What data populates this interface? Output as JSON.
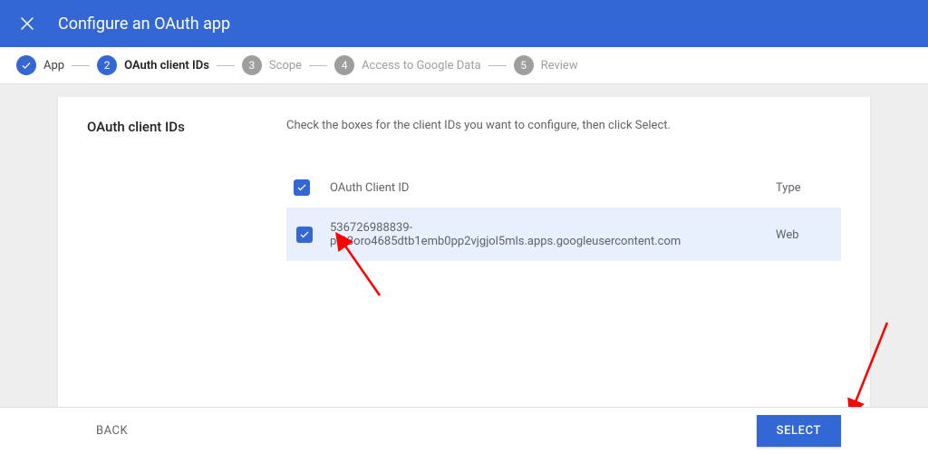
{
  "header": {
    "title": "Configure an OAuth app"
  },
  "stepper": {
    "steps": [
      {
        "label": "App",
        "state": "completed"
      },
      {
        "label": "OAuth client IDs",
        "state": "active",
        "num": "2"
      },
      {
        "label": "Scope",
        "state": "pending",
        "num": "3"
      },
      {
        "label": "Access to Google Data",
        "state": "pending",
        "num": "4"
      },
      {
        "label": "Review",
        "state": "pending",
        "num": "5"
      }
    ]
  },
  "panel": {
    "heading": "OAuth client IDs",
    "instruction": "Check the boxes for the client IDs you want to configure, then click Select.",
    "columns": {
      "id": "OAuth Client ID",
      "type": "Type"
    },
    "rows": [
      {
        "checked": true,
        "client_id": "536726988839-pt93oro4685dtb1emb0pp2vjgjol5mls.apps.googleusercontent.com",
        "type": "Web"
      }
    ]
  },
  "footer": {
    "back": "BACK",
    "select": "SELECT"
  }
}
